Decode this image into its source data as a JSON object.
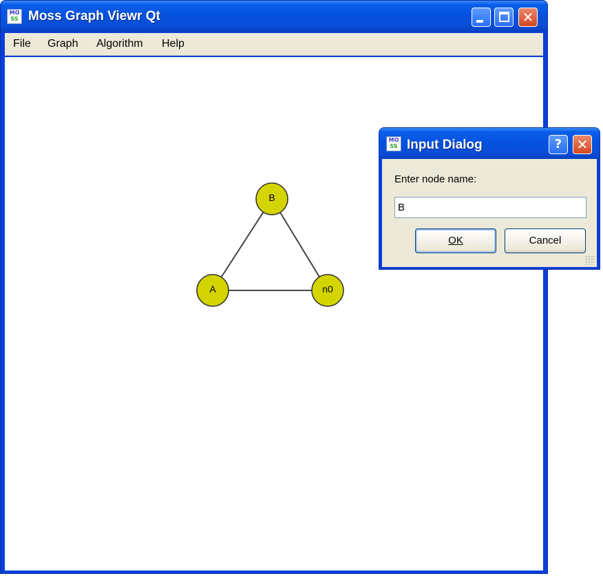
{
  "main_window": {
    "title": "Moss Graph Viewr Qt",
    "menu": [
      "File",
      "Graph",
      "Algorithm",
      "Help"
    ]
  },
  "graph": {
    "nodes": [
      {
        "id": "B",
        "label": "B"
      },
      {
        "id": "A",
        "label": "A"
      },
      {
        "id": "n0",
        "label": "n0"
      }
    ],
    "edges": [
      [
        "B",
        "A"
      ],
      [
        "B",
        "n0"
      ],
      [
        "A",
        "n0"
      ]
    ],
    "node_fill": "#d4d400",
    "node_stroke": "#333333",
    "edge_color": "#444444"
  },
  "dialog": {
    "title": "Input Dialog",
    "prompt": "Enter node name:",
    "input_value": "B",
    "ok_label": "OK",
    "cancel_label": "Cancel"
  },
  "icons": {
    "app": "moss-app-icon",
    "minimize": "minimize-icon",
    "maximize": "maximize-icon",
    "close": "close-icon",
    "help": "help-icon"
  },
  "colors": {
    "titlebar": "#0553e0",
    "menubar": "#ece9d8",
    "close_button": "#d4471f"
  }
}
